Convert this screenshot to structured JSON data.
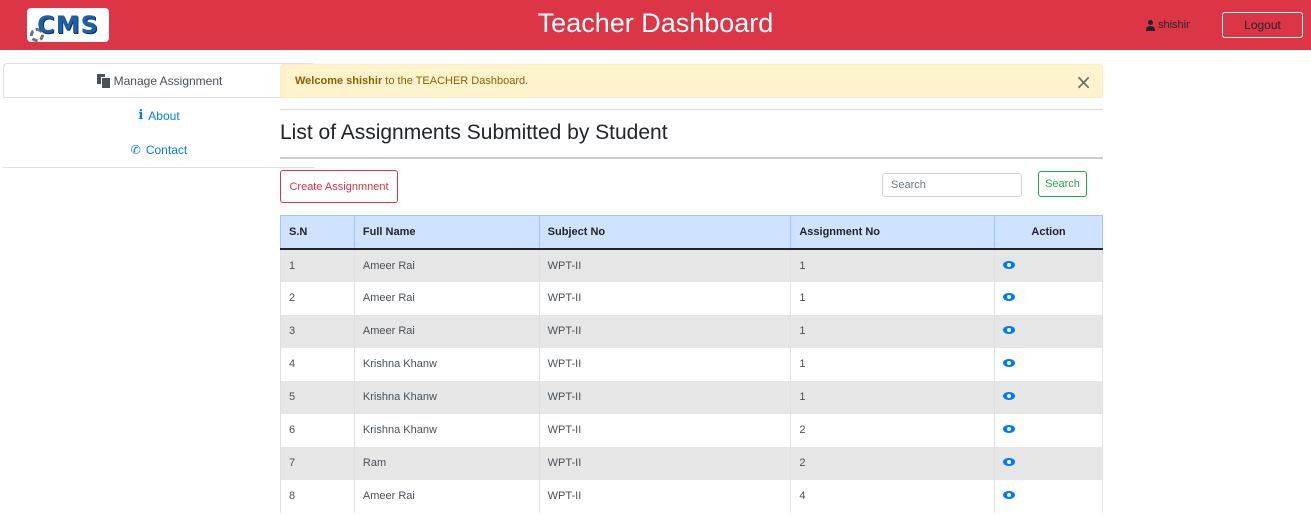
{
  "header": {
    "logo_text": "CMS",
    "title": "Teacher Dashboard",
    "user": "shishir",
    "logout_label": "Logout",
    "color": "#dc3545"
  },
  "sidebar": {
    "items": [
      {
        "label": "Manage Assignment",
        "icon": "files-icon",
        "active": true
      },
      {
        "label": "About",
        "icon": "info-icon",
        "active": false
      },
      {
        "label": "Contact",
        "icon": "phone-icon",
        "active": false
      }
    ]
  },
  "alert": {
    "prefix": "Welcome",
    "name": "shishir",
    "message": "to the TEACHER Dashboard.",
    "close_symbol": "×"
  },
  "main": {
    "title": "List of Assignments Submitted by Student",
    "create_label": "Create Assignmnent",
    "search_placeholder": "Search",
    "search_label": "Search"
  },
  "table": {
    "headers": [
      "S.N",
      "Full Name",
      "Subject No",
      "Assignment No",
      "Action"
    ],
    "rows": [
      {
        "sn": "1",
        "name": "Ameer Rai",
        "subject": "WPT-II",
        "assignment": "1"
      },
      {
        "sn": "2",
        "name": "Ameer Rai",
        "subject": "WPT-II",
        "assignment": "1"
      },
      {
        "sn": "3",
        "name": "Ameer Rai",
        "subject": "WPT-II",
        "assignment": "1"
      },
      {
        "sn": "4",
        "name": "Krishna Khanw",
        "subject": "WPT-II",
        "assignment": "1"
      },
      {
        "sn": "5",
        "name": "Krishna Khanw",
        "subject": "WPT-II",
        "assignment": "1"
      },
      {
        "sn": "6",
        "name": "Krishna Khanw",
        "subject": "WPT-II",
        "assignment": "2"
      },
      {
        "sn": "7",
        "name": "Ram",
        "subject": "WPT-II",
        "assignment": "2"
      },
      {
        "sn": "8",
        "name": "Ameer Rai",
        "subject": "WPT-II",
        "assignment": "4"
      }
    ]
  }
}
